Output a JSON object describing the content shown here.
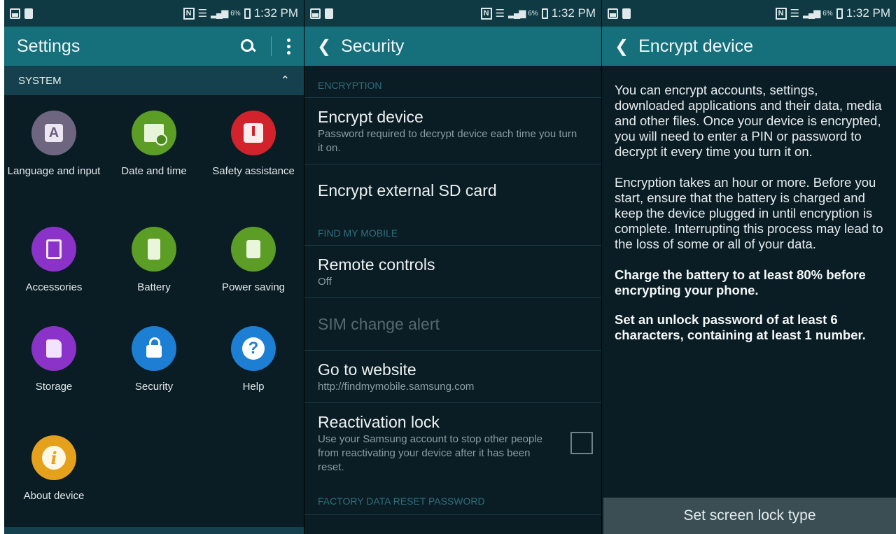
{
  "status_bar": {
    "time": "1:32 PM",
    "battery_pct": "6%",
    "nfc": "N"
  },
  "settings": {
    "title": "Settings",
    "system_header": "SYSTEM",
    "items": [
      {
        "label": "Language and input",
        "color": "#6e6680",
        "icon": "language-icon"
      },
      {
        "label": "Date and time",
        "color": "#5c9d25",
        "icon": "calendar-clock-icon"
      },
      {
        "label": "Safety assistance",
        "color": "#d2222b",
        "icon": "alert-icon"
      },
      {
        "label": "Accessories",
        "color": "#8b32c9",
        "icon": "accessories-icon"
      },
      {
        "label": "Battery",
        "color": "#5c9d25",
        "icon": "battery-icon"
      },
      {
        "label": "Power saving",
        "color": "#5c9d25",
        "icon": "recycle-battery-icon"
      },
      {
        "label": "Storage",
        "color": "#8b32c9",
        "icon": "sd-card-icon"
      },
      {
        "label": "Security",
        "color": "#1c7fd4",
        "icon": "lock-icon"
      },
      {
        "label": "Help",
        "color": "#1c7fd4",
        "icon": "help-icon"
      },
      {
        "label": "About device",
        "color": "#e5a11c",
        "icon": "info-icon"
      }
    ]
  },
  "security": {
    "title": "Security",
    "sections": {
      "encryption": "ENCRYPTION",
      "find_my_mobile": "FIND MY MOBILE",
      "factory_reset": "FACTORY DATA RESET PASSWORD"
    },
    "encrypt_device": {
      "title": "Encrypt device",
      "sub": "Password required to decrypt device each time you turn it on."
    },
    "encrypt_sd": {
      "title": "Encrypt external SD card"
    },
    "remote_controls": {
      "title": "Remote controls",
      "sub": "Off"
    },
    "sim_change": {
      "title": "SIM change alert"
    },
    "website": {
      "title": "Go to website",
      "sub": "http://findmymobile.samsung.com"
    },
    "reactivation": {
      "title": "Reactivation lock",
      "sub": "Use your Samsung account to stop other people from reactivating your device after it has been reset.",
      "checked": false
    }
  },
  "encrypt": {
    "title": "Encrypt device",
    "para1": "You can encrypt accounts, settings, downloaded applications and their data, media and other files. Once your device is encrypted, you will need to enter a PIN or password to decrypt it every time you turn it on.",
    "para2": "Encryption takes an hour or more. Before you start, ensure that the battery is charged and keep the device plugged in until encryption is complete. Interrupting this process may lead to the loss of some or all of your data.",
    "bold1": "Charge the battery to at least 80% before encrypting your phone.",
    "bold2": "Set an unlock password of at least 6 characters, containing at least 1 number.",
    "button": "Set screen lock type"
  }
}
